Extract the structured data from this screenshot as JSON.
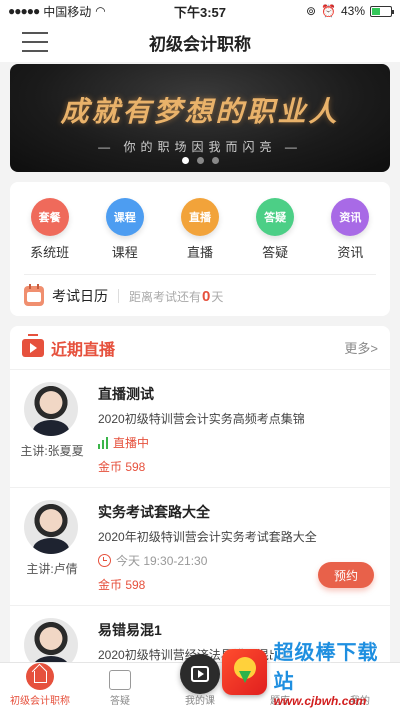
{
  "status_bar": {
    "carrier": "中国移动",
    "time": "下午3:57",
    "battery": "43%",
    "battery_level": 0.43
  },
  "nav": {
    "title": "初级会计职称"
  },
  "banner": {
    "title": "成就有梦想的职业人",
    "subtitle": "— 你的职场因我而闪亮 —",
    "slide_count": 3,
    "active_slide": 1
  },
  "categories": [
    {
      "badge": "套餐",
      "label": "系统班",
      "color": "#ef6a5b"
    },
    {
      "badge": "课程",
      "label": "课程",
      "color": "#4d9df1"
    },
    {
      "badge": "直播",
      "label": "直播",
      "color": "#f2a33a"
    },
    {
      "badge": "答疑",
      "label": "答疑",
      "color": "#4ccf86"
    },
    {
      "badge": "资讯",
      "label": "资讯",
      "color": "#a86ae6"
    }
  ],
  "exam": {
    "title": "考试日历",
    "countdown_prefix": "距离考试还有",
    "days": "0",
    "countdown_suffix": "天"
  },
  "live": {
    "title": "近期直播",
    "more": "更多>",
    "items": [
      {
        "name": "直播测试",
        "desc": "2020初级特训营会计实务高频考点集锦",
        "status": "直播中",
        "price": "金币 598",
        "teacher": "主讲:张夏夏"
      },
      {
        "name": "实务考试套路大全",
        "desc": "2020年初级特训营会计实务考试套路大全",
        "status": "今天 19:30-21:30",
        "price": "金币 598",
        "teacher": "主讲:卢倩",
        "action": "预约"
      },
      {
        "name": "易错易混1",
        "desc": "2020初级特训营经济法易错易混出坑"
      }
    ]
  },
  "tabs": [
    {
      "label": "初级会计职称"
    },
    {
      "label": "答疑"
    },
    {
      "label": "我的课"
    },
    {
      "label": "题库"
    },
    {
      "label": "我的"
    }
  ],
  "watermark": {
    "title": "超级棒下载站",
    "url": "www.cjbwh.com"
  },
  "colors": {
    "accent": "#e6513d",
    "live_green": "#3bb54a"
  }
}
